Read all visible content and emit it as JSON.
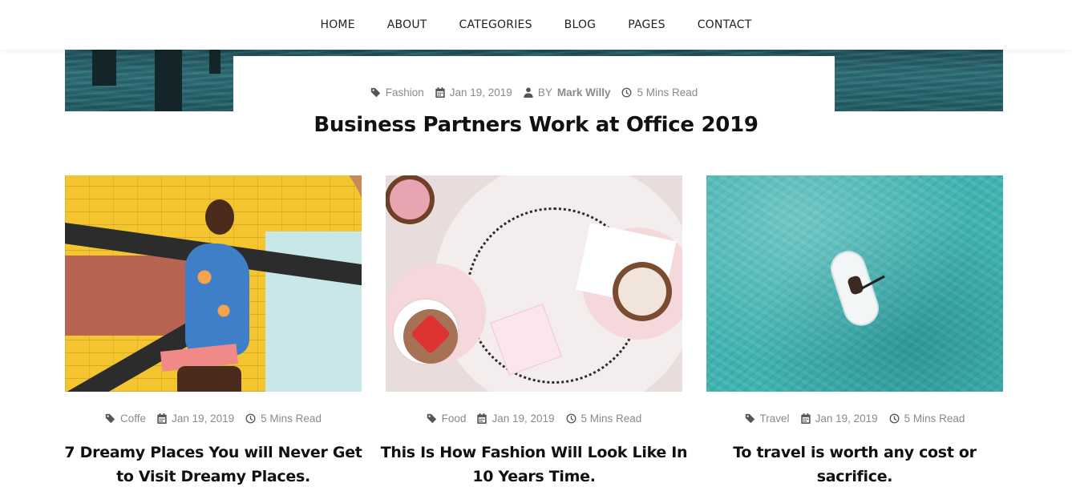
{
  "nav": {
    "items": [
      "HOME",
      "ABOUT",
      "CATEGORIES",
      "BLOG",
      "PAGES",
      "CONTACT"
    ]
  },
  "hero": {
    "category": "Fashion",
    "date": "Jan 19, 2019",
    "by": "BY",
    "author": "Mark Willy",
    "read_time": "5 Mins Read",
    "title": "Business Partners Work at Office 2019"
  },
  "cards": [
    {
      "category": "Coffe",
      "date": "Jan 19, 2019",
      "read_time": "5 Mins Read",
      "title": "7 Dreamy Places You will Never Get to Visit Dreamy Places."
    },
    {
      "category": "Food",
      "date": "Jan 19, 2019",
      "read_time": "5 Mins Read",
      "title": "This Is How Fashion Will Look Like In 10 Years Time."
    },
    {
      "category": "Travel",
      "date": "Jan 19, 2019",
      "read_time": "5 Mins Read",
      "title": "To travel is worth any cost or sacrifice."
    }
  ],
  "icons": {
    "category": "tag-icon",
    "date": "calendar-icon",
    "author": "user-icon",
    "read_time": "clock-icon"
  },
  "colors": {
    "meta_text": "#8a8a8a",
    "title_text": "#111111",
    "background": "#ffffff"
  }
}
